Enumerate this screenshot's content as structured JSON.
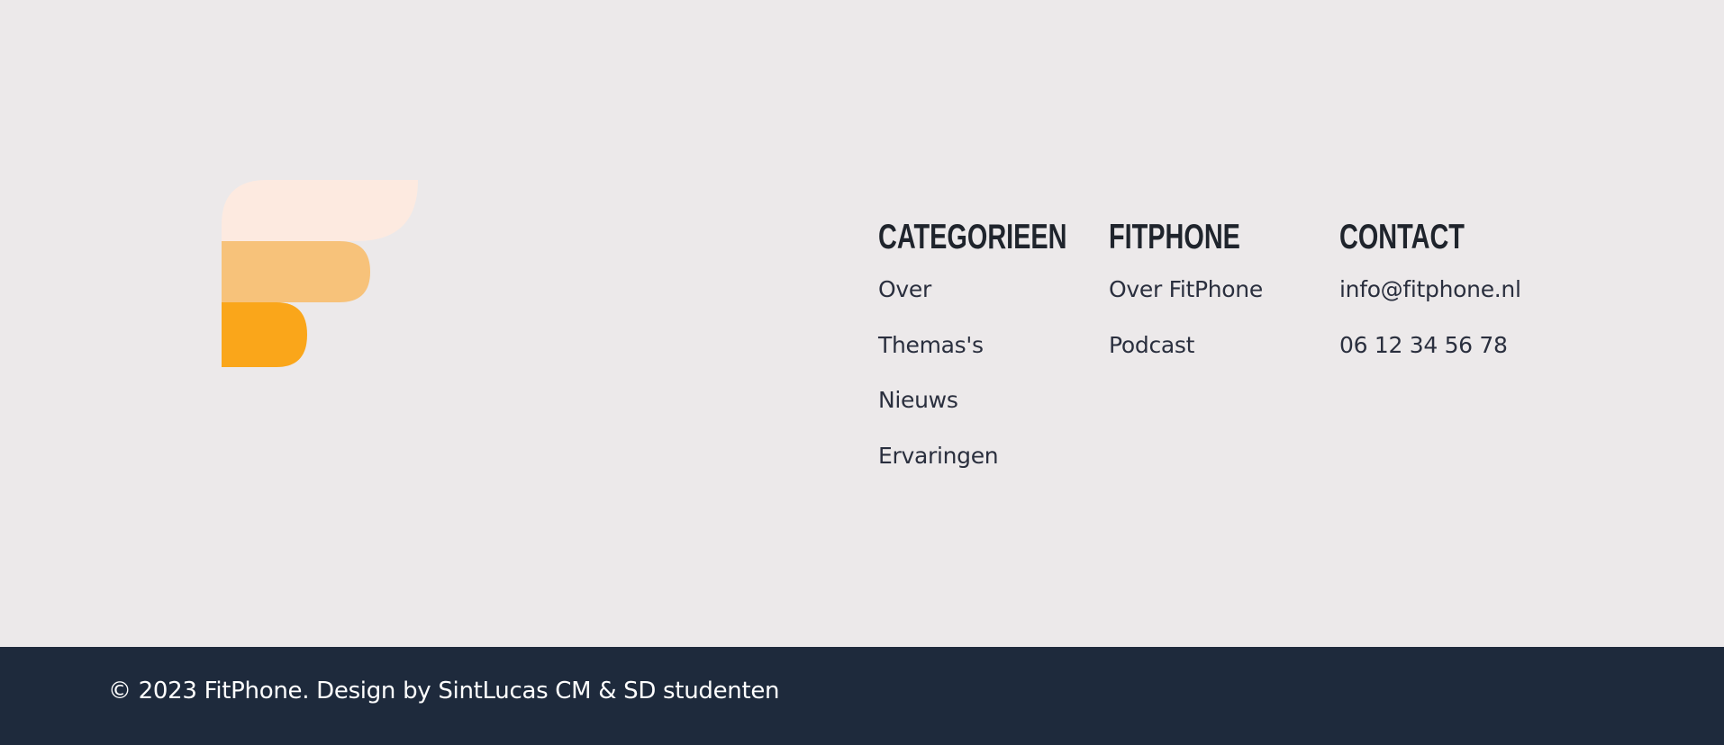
{
  "brand": {
    "logo_icon": "fitphone-f-logo",
    "colors": {
      "logo_top": "#FDEAE0",
      "logo_middle": "#F7C27A",
      "logo_bottom": "#FAA61A",
      "footer_bg": "#ECE9EA",
      "bar_bg": "#1E2A3C",
      "heading": "#1F242C",
      "link": "#2A2F3E"
    }
  },
  "columns": [
    {
      "title": "CATEGORIEEN",
      "links": [
        "Over",
        "Themas's",
        "Nieuws",
        "Ervaringen"
      ]
    },
    {
      "title": "FITPHONE",
      "links": [
        "Over FitPhone",
        "Podcast"
      ]
    },
    {
      "title": "CONTACT",
      "links": [
        "info@fitphone.nl",
        "06 12 34 56 78"
      ]
    }
  ],
  "bottom_bar": {
    "copyright": "© 2023 FitPhone. Design by SintLucas CM & SD studenten"
  }
}
